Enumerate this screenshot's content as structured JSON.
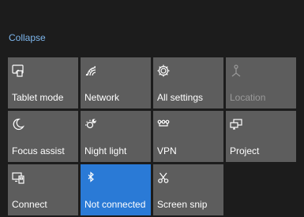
{
  "header": {
    "collapse_label": "Collapse"
  },
  "colors": {
    "background": "#1c1c1c",
    "tile": "#5d5d5d",
    "tile_active": "#2a7ad6",
    "link": "#7db6ec",
    "text_disabled": "#9a9a9a"
  },
  "tiles": [
    {
      "label": "Tablet mode",
      "icon": "tablet-mode-icon",
      "state": "off"
    },
    {
      "label": "Network",
      "icon": "network-icon",
      "state": "off"
    },
    {
      "label": "All settings",
      "icon": "gear-icon",
      "state": "off"
    },
    {
      "label": "Location",
      "icon": "location-icon",
      "state": "disabled"
    },
    {
      "label": "Focus assist",
      "icon": "moon-icon",
      "state": "off"
    },
    {
      "label": "Night light",
      "icon": "night-light-icon",
      "state": "off"
    },
    {
      "label": "VPN",
      "icon": "vpn-icon",
      "state": "off"
    },
    {
      "label": "Project",
      "icon": "project-icon",
      "state": "off"
    },
    {
      "label": "Connect",
      "icon": "connect-icon",
      "state": "off"
    },
    {
      "label": "Not connected",
      "icon": "bluetooth-icon",
      "state": "on"
    },
    {
      "label": "Screen snip",
      "icon": "screen-snip-icon",
      "state": "off"
    }
  ]
}
